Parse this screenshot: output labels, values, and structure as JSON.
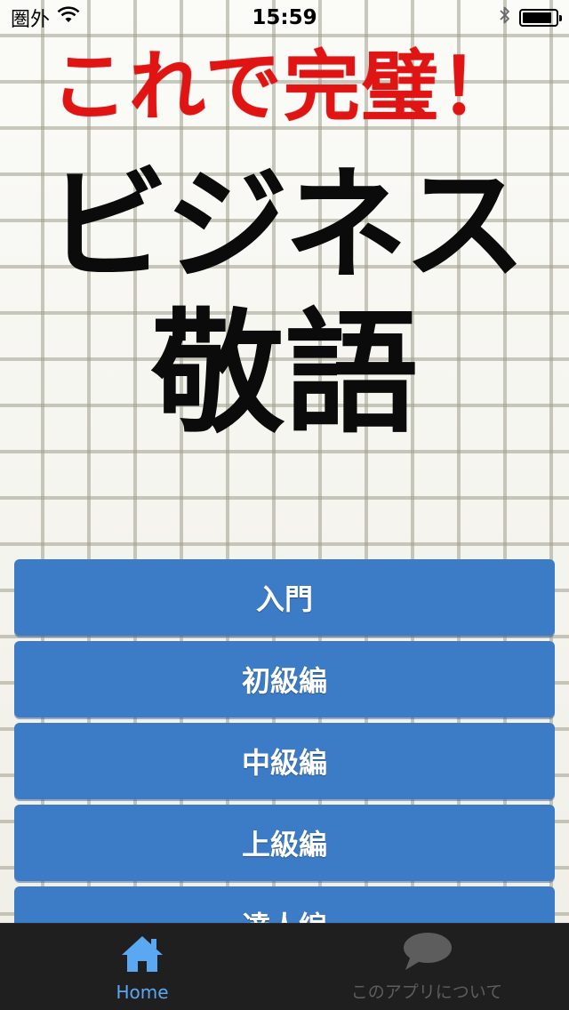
{
  "status_bar": {
    "carrier": "圏外",
    "time": "15:59",
    "battery_level_percent": 90
  },
  "header": {
    "subtitle": "これで完璧！",
    "title_line1": "ビジネス",
    "title_line2": "敬語",
    "subtitle_color": "#e11414",
    "title_color": "#0b0b0b"
  },
  "menu": {
    "items": [
      {
        "label": "入門"
      },
      {
        "label": "初級編"
      },
      {
        "label": "中級編"
      },
      {
        "label": "上級編"
      },
      {
        "label": "達人編"
      }
    ],
    "button_color": "#3c7cc7"
  },
  "tab_bar": {
    "tabs": [
      {
        "label": "Home",
        "icon": "house-icon",
        "selected": true
      },
      {
        "label": "このアプリについて",
        "icon": "speech-bubble-icon",
        "selected": false
      }
    ],
    "active_color": "#5aa8f2",
    "inactive_color": "#5d5d5d"
  }
}
